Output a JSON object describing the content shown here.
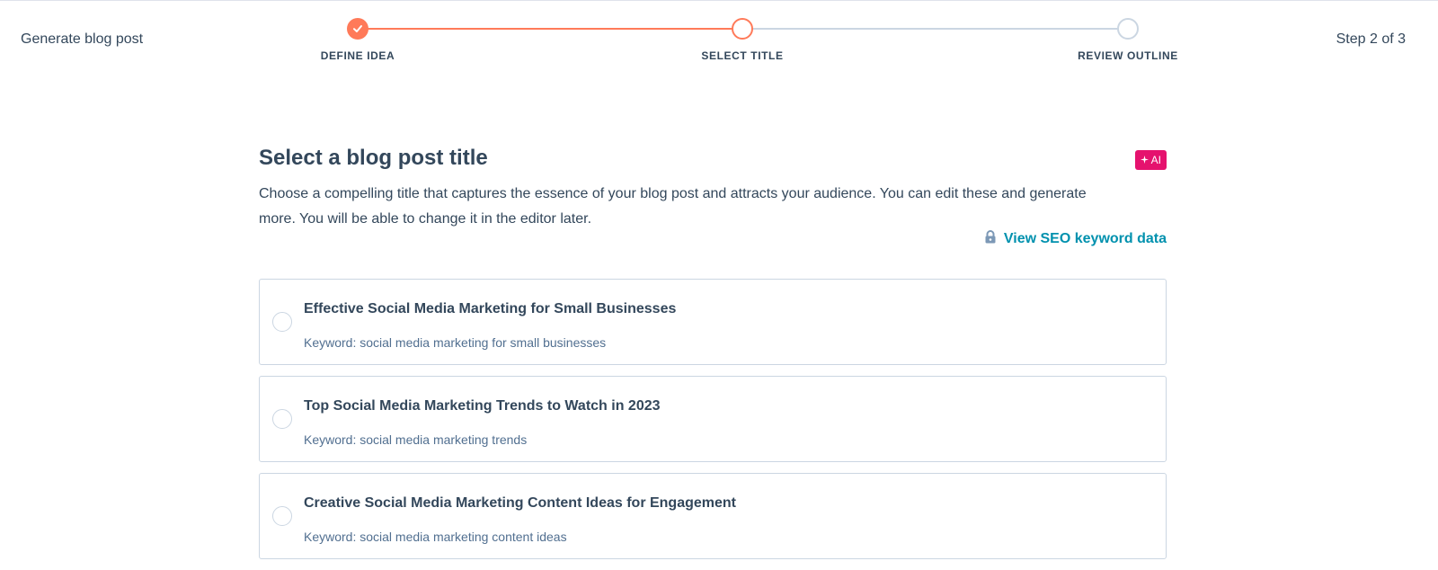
{
  "header": {
    "app_title": "Generate blog post",
    "step_counter": "Step 2 of 3"
  },
  "stepper": {
    "steps": [
      {
        "label": "DEFINE IDEA",
        "state": "completed"
      },
      {
        "label": "SELECT TITLE",
        "state": "active"
      },
      {
        "label": "REVIEW OUTLINE",
        "state": "pending"
      }
    ]
  },
  "main": {
    "heading": "Select a blog post title",
    "ai_badge": "AI",
    "description": "Choose a compelling title that captures the essence of your blog post and attracts your audience. You can edit these and generate more. You will be able to change it in the editor later.",
    "seo_link": "View SEO keyword data"
  },
  "options": [
    {
      "title": "Effective Social Media Marketing for Small Businesses",
      "keyword": "Keyword: social media marketing for small businesses",
      "selected": false
    },
    {
      "title": "Top Social Media Marketing Trends to Watch in 2023",
      "keyword": "Keyword: social media marketing trends",
      "selected": false
    },
    {
      "title": "Creative Social Media Marketing Content Ideas for Engagement",
      "keyword": "Keyword: social media marketing content ideas",
      "selected": false
    }
  ],
  "colors": {
    "accent": "#ff7a59",
    "ai_badge": "#e5126e",
    "link": "#0091ae",
    "text": "#33475b"
  }
}
